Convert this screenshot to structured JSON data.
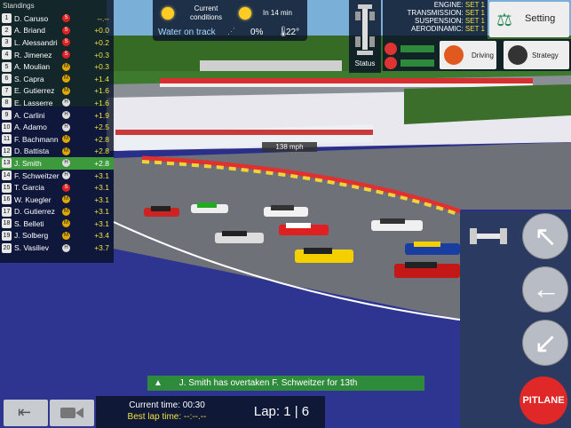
{
  "standings": {
    "title": "Standings",
    "rows": [
      {
        "pos": "1",
        "name": "D. Caruso",
        "tyre": "S",
        "gap": "--.--"
      },
      {
        "pos": "2",
        "name": "A. Briand",
        "tyre": "S",
        "gap": "+0.0"
      },
      {
        "pos": "3",
        "name": "L. Alessandri",
        "tyre": "S",
        "gap": "+0.2"
      },
      {
        "pos": "4",
        "name": "R. Jimenez",
        "tyre": "S",
        "gap": "+0.3"
      },
      {
        "pos": "5",
        "name": "A. Moulian",
        "tyre": "M",
        "gap": "+0.3"
      },
      {
        "pos": "6",
        "name": "S. Capra",
        "tyre": "M",
        "gap": "+1.4"
      },
      {
        "pos": "7",
        "name": "E. Gutierrez",
        "tyre": "M",
        "gap": "+1.6"
      },
      {
        "pos": "8",
        "name": "E. Lasserre",
        "tyre": "H",
        "gap": "+1.6"
      },
      {
        "pos": "9",
        "name": "A. Carlini",
        "tyre": "H",
        "gap": "+1.9"
      },
      {
        "pos": "10",
        "name": "A. Adamo",
        "tyre": "H",
        "gap": "+2.5"
      },
      {
        "pos": "11",
        "name": "F. Bachmann",
        "tyre": "M",
        "gap": "+2.8"
      },
      {
        "pos": "12",
        "name": "D. Battista",
        "tyre": "M",
        "gap": "+2.8"
      },
      {
        "pos": "13",
        "name": "J. Smith",
        "tyre": "H",
        "gap": "+2.8",
        "highlight": true
      },
      {
        "pos": "14",
        "name": "F. Schweitzer",
        "tyre": "H",
        "gap": "+3.1"
      },
      {
        "pos": "15",
        "name": "T. Garcia",
        "tyre": "S",
        "gap": "+3.1"
      },
      {
        "pos": "16",
        "name": "W. Kuegler",
        "tyre": "M",
        "gap": "+3.1"
      },
      {
        "pos": "17",
        "name": "D. Gutierrez",
        "tyre": "M",
        "gap": "+3.1"
      },
      {
        "pos": "18",
        "name": "S. Belleti",
        "tyre": "M",
        "gap": "+3.1"
      },
      {
        "pos": "19",
        "name": "J. Solberg",
        "tyre": "M",
        "gap": "+3.4"
      },
      {
        "pos": "20",
        "name": "S. Vasiliev",
        "tyre": "H",
        "gap": "+3.7"
      }
    ]
  },
  "conditions": {
    "current_label": "Current conditions",
    "forecast_label": "In 14 min",
    "track_state": "Water on track",
    "rain_percent": "0%",
    "temperature": "22°"
  },
  "status_label": "Status",
  "setup": {
    "engine_label": "ENGINE:",
    "engine_value": "SET 1",
    "transmission_label": "TRANSMISSION:",
    "transmission_value": "SET 1",
    "suspension_label": "SUSPENSION:",
    "suspension_value": "SET 1",
    "aero_label": "AERODINAMIC:",
    "aero_value": "SET 1"
  },
  "setting_button": "Setting",
  "driving_button": "Driving",
  "strategy_button": "Strategy",
  "speed": "138 mph",
  "message": "J. Smith has overtaken F. Schweitzer for 13th",
  "current_time_label": "Current time:",
  "current_time": "00:30",
  "best_lap_label": "Best lap time:",
  "best_lap": "--:--.--",
  "lap": "Lap: 1 | 6",
  "pitlane_label": "PITLANE",
  "colors": {
    "highlight": "#3c9a3c",
    "pitlane": "#e02828",
    "banner": "#2e8b3b"
  }
}
